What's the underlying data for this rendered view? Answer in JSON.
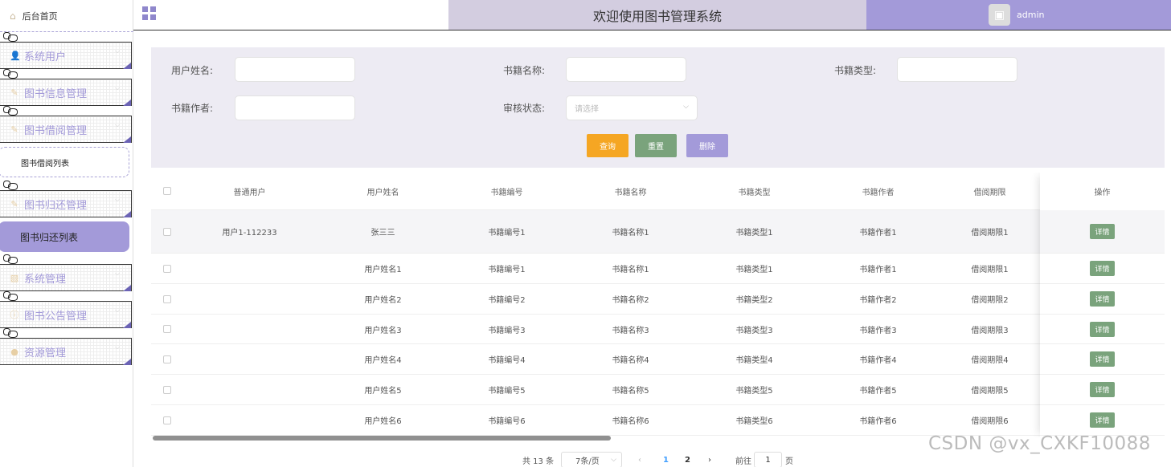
{
  "sidebar": {
    "home_label": "后台首页",
    "menus": [
      {
        "label": "系统用户",
        "icon": "user-icon"
      },
      {
        "label": "图书信息管理",
        "icon": "edit-icon"
      },
      {
        "label": "图书借阅管理",
        "icon": "edit-icon"
      },
      {
        "label": "图书归还管理",
        "icon": "edit-icon"
      },
      {
        "label": "系统管理",
        "icon": "picture-icon"
      },
      {
        "label": "图书公告管理",
        "icon": "info-icon"
      },
      {
        "label": "资源管理",
        "icon": "bulb-icon"
      }
    ],
    "sub_borrow_list": "图书借阅列表",
    "sub_return_list": "图书归还列表"
  },
  "header": {
    "title": "欢迎使用图书管理系统",
    "username": "admin"
  },
  "search": {
    "user_name_label": "用户姓名:",
    "book_name_label": "书籍名称:",
    "book_type_label": "书籍类型:",
    "book_author_label": "书籍作者:",
    "audit_status_label": "审核状态:",
    "audit_status_placeholder": "请选择",
    "query_btn": "查询",
    "reset_btn": "重置",
    "delete_btn": "删除"
  },
  "colors": {
    "accent": "#a39ad9",
    "query": "#f5a623",
    "reset": "#7aa37c",
    "delete": "#a39ad9"
  },
  "table": {
    "headers": [
      "普通用户",
      "用户姓名",
      "书籍编号",
      "书籍名称",
      "书籍类型",
      "书籍作者",
      "借阅期限",
      "操作"
    ],
    "detail_label": "详情",
    "rows": [
      [
        "用户1-112233",
        "张三三",
        "书籍编号1",
        "书籍名称1",
        "书籍类型1",
        "书籍作者1",
        "借阅期限1"
      ],
      [
        "",
        "用户姓名1",
        "书籍编号1",
        "书籍名称1",
        "书籍类型1",
        "书籍作者1",
        "借阅期限1"
      ],
      [
        "",
        "用户姓名2",
        "书籍编号2",
        "书籍名称2",
        "书籍类型2",
        "书籍作者2",
        "借阅期限2"
      ],
      [
        "",
        "用户姓名3",
        "书籍编号3",
        "书籍名称3",
        "书籍类型3",
        "书籍作者3",
        "借阅期限3"
      ],
      [
        "",
        "用户姓名4",
        "书籍编号4",
        "书籍名称4",
        "书籍类型4",
        "书籍作者4",
        "借阅期限4"
      ],
      [
        "",
        "用户姓名5",
        "书籍编号5",
        "书籍名称5",
        "书籍类型5",
        "书籍作者5",
        "借阅期限5"
      ],
      [
        "",
        "用户姓名6",
        "书籍编号6",
        "书籍名称6",
        "书籍类型6",
        "书籍作者6",
        "借阅期限6"
      ]
    ]
  },
  "pager": {
    "total": "共 13 条",
    "page_size": "7条/页",
    "pages": [
      "1",
      "2"
    ],
    "goto_prefix": "前往",
    "goto_value": "1",
    "goto_suffix": "页"
  },
  "watermark": "CSDN @vx_CXKF10088"
}
